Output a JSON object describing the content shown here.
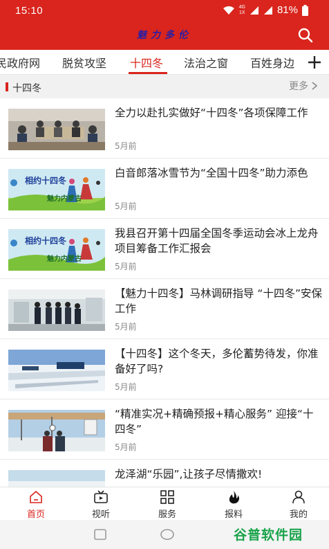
{
  "status_bar": {
    "time": "15:10",
    "network_label": "4G",
    "network_sub": "1X",
    "battery": "81%",
    "icons": [
      "wifi-icon",
      "signal-icon",
      "signal-icon",
      "battery-icon"
    ]
  },
  "header": {
    "title": "魅力多伦",
    "search_icon": "search-icon",
    "bg_color": "#d9251d"
  },
  "tabs": {
    "items": [
      {
        "label": "民政府网"
      },
      {
        "label": "脱贫攻坚"
      },
      {
        "label": "十四冬"
      },
      {
        "label": "法治之窗"
      },
      {
        "label": "百姓身边"
      }
    ],
    "active_index": 2,
    "add_icon": "plus-icon"
  },
  "section": {
    "title": "十四冬",
    "more_label": "更多"
  },
  "news": [
    {
      "title": "全力以赴扎实做好“十四冬”各项保障工作",
      "time": "5月前",
      "thumb": "meeting-photo"
    },
    {
      "title": "白音郎落冰雪节为“全国十四冬”助力添色",
      "time": "5月前",
      "thumb": "poster-image"
    },
    {
      "title": "我县召开第十四届全国冬季运动会冰上龙舟项目筹备工作汇报会",
      "time": "5月前",
      "thumb": "poster-image"
    },
    {
      "title": "【魅力十四冬】马林调研指导 “十四冬”安保工作",
      "time": "5月前",
      "thumb": "indoor-photo"
    },
    {
      "title": "【十四冬】这个冬天，多伦蓄势待发，你准备好了吗?",
      "time": "5月前",
      "thumb": "snow-photo"
    },
    {
      "title": "“精准实况+精确预报+精心服务” 迎接“十四冬”",
      "time": "5月前",
      "thumb": "station-photo"
    },
    {
      "title": "龙泽湖“乐园”,让孩子尽情撒欢!",
      "time": "",
      "thumb": "lake-photo"
    }
  ],
  "poster": {
    "headline": "相约十四冬",
    "slogan": "魅力内蒙古"
  },
  "bottom_nav": {
    "items": [
      {
        "label": "首页",
        "icon": "home-icon"
      },
      {
        "label": "视听",
        "icon": "tv-icon"
      },
      {
        "label": "服务",
        "icon": "grid-icon"
      },
      {
        "label": "报料",
        "icon": "fire-icon"
      },
      {
        "label": "我的",
        "icon": "user-icon"
      }
    ],
    "active_index": 0
  },
  "system_nav": {
    "icons": [
      "recent-apps-icon",
      "home-circle-icon"
    ]
  },
  "watermark": {
    "text": "谷普软件园"
  },
  "colors": {
    "accent": "#d9251d",
    "title_text": "#2b1fa3",
    "muted": "#888888"
  }
}
